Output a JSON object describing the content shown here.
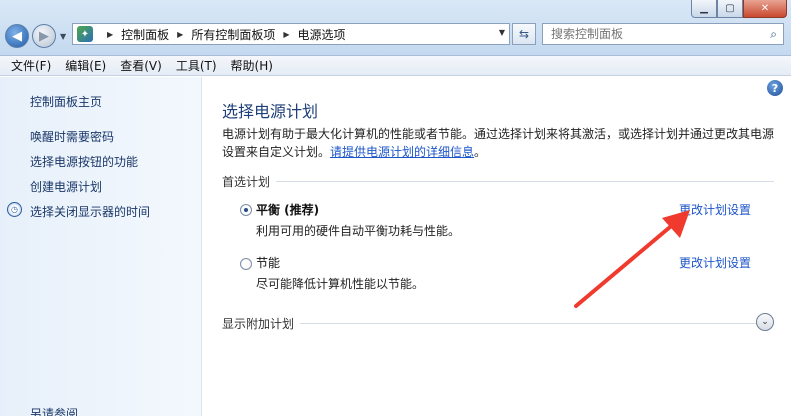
{
  "window": {
    "minimize_glyph": "▁",
    "maximize_glyph": "▢",
    "close_glyph": "✕"
  },
  "nav": {
    "back_glyph": "◀",
    "forward_glyph": "▶",
    "dropdown_glyph": "▼",
    "refresh_glyph": "⇆"
  },
  "breadcrumb": [
    "控制面板",
    "所有控制面板项",
    "电源选项"
  ],
  "search": {
    "placeholder": "搜索控制面板"
  },
  "menu": [
    "文件(F)",
    "编辑(E)",
    "查看(V)",
    "工具(T)",
    "帮助(H)"
  ],
  "sidebar": {
    "home": "控制面板主页",
    "items": [
      "唤醒时需要密码",
      "选择电源按钮的功能",
      "创建电源计划",
      "选择关闭显示器的时间"
    ],
    "partial": "另请参阅"
  },
  "main": {
    "title": "选择电源计划",
    "desc_text": "电源计划有助于最大化计算机的性能或者节能。通过选择计划来将其激活，或选择计划并通过更改其电源设置来自定义计划。",
    "desc_link": "请提供电源计划的详细信息",
    "desc_end": "。",
    "section_preferred": "首选计划",
    "section_additional": "显示附加计划",
    "plans": [
      {
        "name": "平衡 (推荐)",
        "desc": "利用可用的硬件自动平衡功耗与性能。",
        "selected": true,
        "change": "更改计划设置"
      },
      {
        "name": "节能",
        "desc": "尽可能降低计算机性能以节能。",
        "selected": false,
        "change": "更改计划设置"
      }
    ],
    "help_glyph": "?",
    "expand_glyph": "⌄"
  },
  "annotation": {
    "arrow_color": "#f03a2e"
  }
}
